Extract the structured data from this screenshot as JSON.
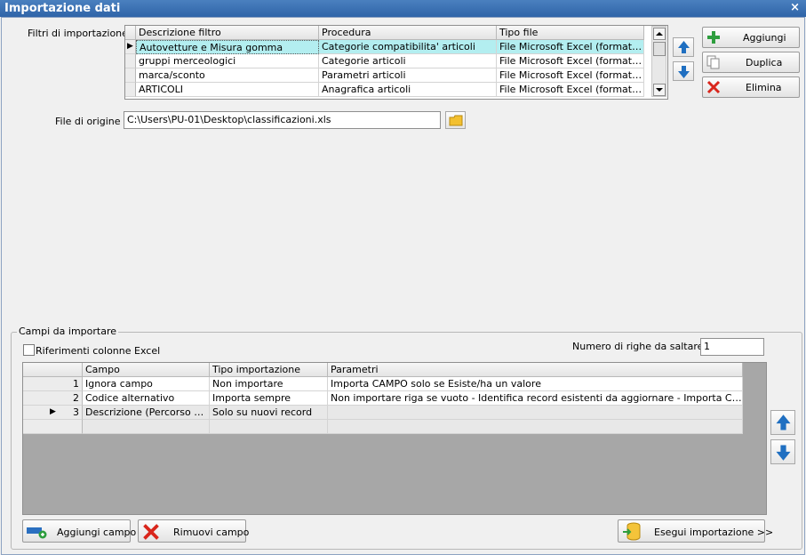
{
  "window": {
    "title": "Importazione dati",
    "close": "×"
  },
  "filters": {
    "label": "Filtri di importazione :",
    "columns": [
      "Descrizione filtro",
      "Procedura",
      "Tipo file"
    ],
    "rows": [
      {
        "descr": "Autovetture e Misura gomma",
        "proc": "Categorie compatibilita' articoli",
        "tipo": "File Microsoft Excel (formato cl..."
      },
      {
        "descr": "gruppi merceologici",
        "proc": "Categorie articoli",
        "tipo": "File Microsoft Excel (formato cl..."
      },
      {
        "descr": "marca/sconto",
        "proc": "Parametri articoli",
        "tipo": "File Microsoft Excel (formato cl..."
      },
      {
        "descr": "ARTICOLI",
        "proc": "Anagrafica articoli",
        "tipo": "File Microsoft Excel (formato cl..."
      }
    ],
    "selected_marker": "▶",
    "buttons": {
      "add": "Aggiungi",
      "dup": "Duplica",
      "del": "Elimina"
    }
  },
  "origin": {
    "label": "File di origine :",
    "value": "C:\\Users\\PU-01\\Desktop\\classificazioni.xls"
  },
  "fields": {
    "group_title": "Campi da importare",
    "excel_refs_label": "Riferimenti colonne Excel",
    "skip_label": "Numero di righe da saltare  :",
    "skip_value": "1",
    "columns": [
      "Campo",
      "Tipo importazione",
      "Parametri"
    ],
    "rows": [
      {
        "n": "1",
        "campo": "Ignora campo",
        "tipo": "Non importare",
        "param": "Importa CAMPO solo se Esiste/ha un valore"
      },
      {
        "n": "2",
        "campo": "Codice alternativo",
        "tipo": "Importa sempre",
        "param": "Non importare riga se vuoto - Identifica record esistenti da aggiornare - Importa CAMPO solo ..."
      },
      {
        "n": "3",
        "campo": "Descrizione (Percorso com...",
        "tipo": "Solo su nuovi record",
        "param": ""
      }
    ],
    "current_marker": "▶",
    "buttons": {
      "add_field": "Aggiungi campo",
      "remove_field": "Rimuovi campo",
      "run": "Esegui importazione >>"
    }
  },
  "colors": {
    "title_bg": "#2f64a8",
    "selection": "#b3eef0",
    "arrow_blue": "#1f6fc1",
    "add_green": "#2e9e3e",
    "delete_red": "#d9261c"
  }
}
